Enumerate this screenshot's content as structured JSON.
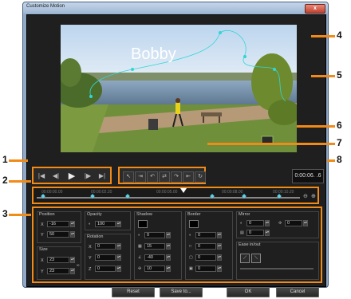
{
  "window": {
    "title": "Customize Motion",
    "close_label": "x"
  },
  "preview": {
    "overlay_text": "Bobby"
  },
  "playback": {
    "buttons": [
      "|◀",
      "◀|",
      "▶",
      "|▶",
      "▶|"
    ]
  },
  "edit_tools": {
    "buttons": [
      "↖",
      "⇥",
      "↶",
      "⇄",
      "↷",
      "⇤",
      "↻"
    ]
  },
  "time": {
    "current": "0:00:06. .6"
  },
  "timeline": {
    "ticks": [
      "00:00:00.00",
      "00:00:02.20",
      "00:00:05.00",
      "00:00:08.00",
      "00:00:10.20"
    ]
  },
  "properties": {
    "position": {
      "label": "Position",
      "x_label": "X",
      "x": "-16",
      "y_label": "Y",
      "y": "50"
    },
    "size": {
      "label": "Size",
      "x_label": "X",
      "x": "23",
      "y_label": "Y",
      "y": "23"
    },
    "opacity": {
      "label": "Opacity",
      "value": "100"
    },
    "rotation": {
      "label": "Rotation",
      "x_label": "X",
      "x": "0",
      "y_label": "Y",
      "y": "0",
      "z_label": "Z",
      "z": "0"
    },
    "shadow": {
      "label": "Shadow",
      "v1": "0",
      "v2": "15",
      "v3": "-40",
      "v4": "10"
    },
    "border": {
      "label": "Border",
      "v1": "0",
      "v2": "0",
      "v3": "0",
      "v4": "0"
    },
    "mirror": {
      "label": "Mirror",
      "v1": "0",
      "v2": "0",
      "v3": "0"
    },
    "ease": {
      "label": "Ease in/out"
    }
  },
  "buttons": {
    "reset": "Reset",
    "save": "Save to...",
    "ok": "OK",
    "cancel": "Cancel"
  },
  "callouts": [
    "1",
    "2",
    "3",
    "4",
    "5",
    "6",
    "7",
    "8"
  ],
  "colors": {
    "accent": "#f28a17",
    "keyframe": "#5ed1e6",
    "path": "#2fd6d6"
  }
}
